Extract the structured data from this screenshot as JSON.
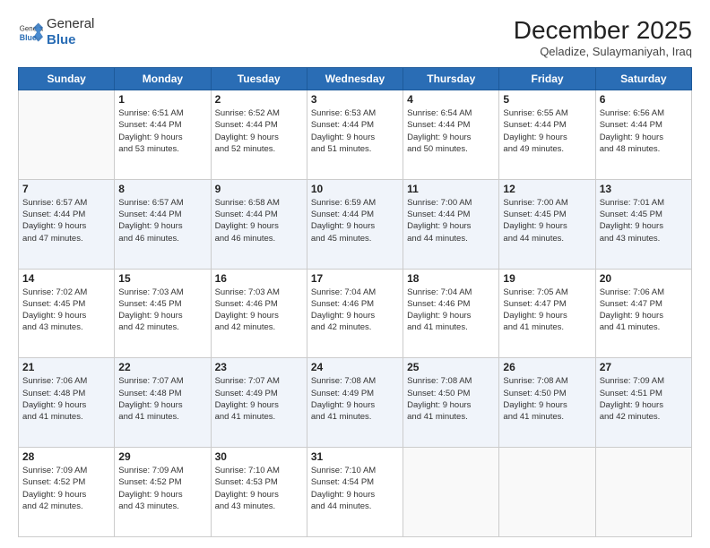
{
  "header": {
    "logo_general": "General",
    "logo_blue": "Blue",
    "month_year": "December 2025",
    "location": "Qeladize, Sulaymaniyah, Iraq"
  },
  "days_of_week": [
    "Sunday",
    "Monday",
    "Tuesday",
    "Wednesday",
    "Thursday",
    "Friday",
    "Saturday"
  ],
  "weeks": [
    [
      {
        "day": "",
        "info": ""
      },
      {
        "day": "1",
        "info": "Sunrise: 6:51 AM\nSunset: 4:44 PM\nDaylight: 9 hours\nand 53 minutes."
      },
      {
        "day": "2",
        "info": "Sunrise: 6:52 AM\nSunset: 4:44 PM\nDaylight: 9 hours\nand 52 minutes."
      },
      {
        "day": "3",
        "info": "Sunrise: 6:53 AM\nSunset: 4:44 PM\nDaylight: 9 hours\nand 51 minutes."
      },
      {
        "day": "4",
        "info": "Sunrise: 6:54 AM\nSunset: 4:44 PM\nDaylight: 9 hours\nand 50 minutes."
      },
      {
        "day": "5",
        "info": "Sunrise: 6:55 AM\nSunset: 4:44 PM\nDaylight: 9 hours\nand 49 minutes."
      },
      {
        "day": "6",
        "info": "Sunrise: 6:56 AM\nSunset: 4:44 PM\nDaylight: 9 hours\nand 48 minutes."
      }
    ],
    [
      {
        "day": "7",
        "info": "Sunrise: 6:57 AM\nSunset: 4:44 PM\nDaylight: 9 hours\nand 47 minutes."
      },
      {
        "day": "8",
        "info": "Sunrise: 6:57 AM\nSunset: 4:44 PM\nDaylight: 9 hours\nand 46 minutes."
      },
      {
        "day": "9",
        "info": "Sunrise: 6:58 AM\nSunset: 4:44 PM\nDaylight: 9 hours\nand 46 minutes."
      },
      {
        "day": "10",
        "info": "Sunrise: 6:59 AM\nSunset: 4:44 PM\nDaylight: 9 hours\nand 45 minutes."
      },
      {
        "day": "11",
        "info": "Sunrise: 7:00 AM\nSunset: 4:44 PM\nDaylight: 9 hours\nand 44 minutes."
      },
      {
        "day": "12",
        "info": "Sunrise: 7:00 AM\nSunset: 4:45 PM\nDaylight: 9 hours\nand 44 minutes."
      },
      {
        "day": "13",
        "info": "Sunrise: 7:01 AM\nSunset: 4:45 PM\nDaylight: 9 hours\nand 43 minutes."
      }
    ],
    [
      {
        "day": "14",
        "info": "Sunrise: 7:02 AM\nSunset: 4:45 PM\nDaylight: 9 hours\nand 43 minutes."
      },
      {
        "day": "15",
        "info": "Sunrise: 7:03 AM\nSunset: 4:45 PM\nDaylight: 9 hours\nand 42 minutes."
      },
      {
        "day": "16",
        "info": "Sunrise: 7:03 AM\nSunset: 4:46 PM\nDaylight: 9 hours\nand 42 minutes."
      },
      {
        "day": "17",
        "info": "Sunrise: 7:04 AM\nSunset: 4:46 PM\nDaylight: 9 hours\nand 42 minutes."
      },
      {
        "day": "18",
        "info": "Sunrise: 7:04 AM\nSunset: 4:46 PM\nDaylight: 9 hours\nand 41 minutes."
      },
      {
        "day": "19",
        "info": "Sunrise: 7:05 AM\nSunset: 4:47 PM\nDaylight: 9 hours\nand 41 minutes."
      },
      {
        "day": "20",
        "info": "Sunrise: 7:06 AM\nSunset: 4:47 PM\nDaylight: 9 hours\nand 41 minutes."
      }
    ],
    [
      {
        "day": "21",
        "info": "Sunrise: 7:06 AM\nSunset: 4:48 PM\nDaylight: 9 hours\nand 41 minutes."
      },
      {
        "day": "22",
        "info": "Sunrise: 7:07 AM\nSunset: 4:48 PM\nDaylight: 9 hours\nand 41 minutes."
      },
      {
        "day": "23",
        "info": "Sunrise: 7:07 AM\nSunset: 4:49 PM\nDaylight: 9 hours\nand 41 minutes."
      },
      {
        "day": "24",
        "info": "Sunrise: 7:08 AM\nSunset: 4:49 PM\nDaylight: 9 hours\nand 41 minutes."
      },
      {
        "day": "25",
        "info": "Sunrise: 7:08 AM\nSunset: 4:50 PM\nDaylight: 9 hours\nand 41 minutes."
      },
      {
        "day": "26",
        "info": "Sunrise: 7:08 AM\nSunset: 4:50 PM\nDaylight: 9 hours\nand 41 minutes."
      },
      {
        "day": "27",
        "info": "Sunrise: 7:09 AM\nSunset: 4:51 PM\nDaylight: 9 hours\nand 42 minutes."
      }
    ],
    [
      {
        "day": "28",
        "info": "Sunrise: 7:09 AM\nSunset: 4:52 PM\nDaylight: 9 hours\nand 42 minutes."
      },
      {
        "day": "29",
        "info": "Sunrise: 7:09 AM\nSunset: 4:52 PM\nDaylight: 9 hours\nand 43 minutes."
      },
      {
        "day": "30",
        "info": "Sunrise: 7:10 AM\nSunset: 4:53 PM\nDaylight: 9 hours\nand 43 minutes."
      },
      {
        "day": "31",
        "info": "Sunrise: 7:10 AM\nSunset: 4:54 PM\nDaylight: 9 hours\nand 44 minutes."
      },
      {
        "day": "",
        "info": ""
      },
      {
        "day": "",
        "info": ""
      },
      {
        "day": "",
        "info": ""
      }
    ]
  ]
}
